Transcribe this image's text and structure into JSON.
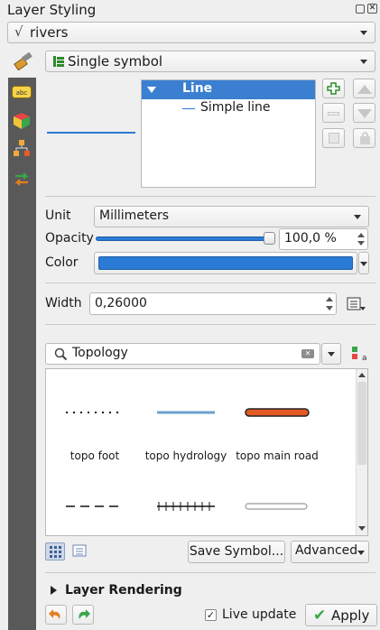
{
  "panel": {
    "title": "Layer Styling"
  },
  "layer_select": {
    "icon": "line-layer-icon",
    "value": "rivers"
  },
  "renderer": {
    "value": "Single symbol"
  },
  "symbol_tree": {
    "root": "Line",
    "child": "Simple line"
  },
  "unit": {
    "label": "Unit",
    "value": "Millimeters"
  },
  "opacity": {
    "label": "Opacity",
    "value": "100,0 %",
    "fraction": 1.0
  },
  "color": {
    "label": "Color",
    "swatch": "#2a7bd6"
  },
  "width": {
    "label": "Width",
    "value": "0,26000"
  },
  "search": {
    "value": "Topology"
  },
  "symbols": [
    {
      "name": "topo foot",
      "style": "dotted",
      "color": "#111111"
    },
    {
      "name": "topo hydrology",
      "style": "solid",
      "color": "#6fa0d2"
    },
    {
      "name": "topo main road",
      "style": "thick-outline",
      "color": "#e45a24"
    },
    {
      "name": "",
      "style": "dashed",
      "color": "#111111"
    },
    {
      "name": "",
      "style": "ticks",
      "color": "#111111"
    },
    {
      "name": "",
      "style": "double",
      "color": "#999999"
    }
  ],
  "buttons": {
    "save_symbol": "Save Symbol...",
    "advanced": "Advanced",
    "apply": "Apply"
  },
  "layer_rendering": {
    "label": "Layer Rendering"
  },
  "live_update": {
    "label": "Live update",
    "checked": true
  },
  "colors": {
    "accent": "#2a7bd6",
    "selection": "#3b7fd1"
  }
}
